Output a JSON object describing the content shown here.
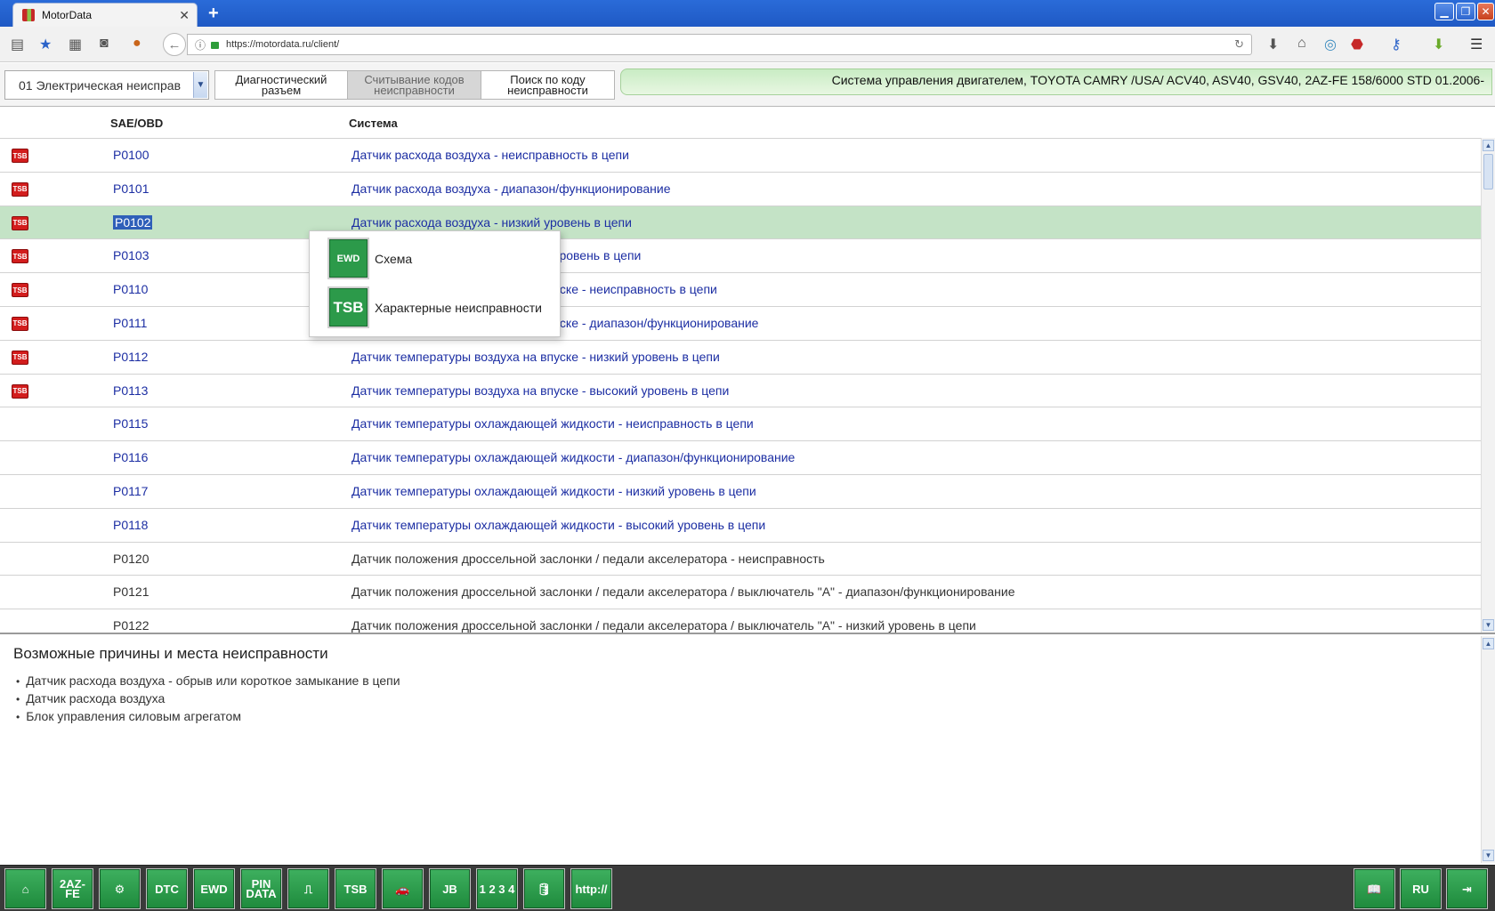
{
  "browser": {
    "tab_title": "MotorData",
    "url": "https://motordata.ru/client/",
    "newtab_label": "+",
    "tab_close": "✕"
  },
  "header": {
    "section_select": "01 Электрическая неисправ",
    "tabs": [
      {
        "label": "Диагностический разъем"
      },
      {
        "label": "Считывание кодов неисправности"
      },
      {
        "label": "Поиск по коду неисправности"
      }
    ],
    "vehicle": "Система управления двигателем, TOYOTA CAMRY /USA/ ACV40, ASV40, GSV40, 2AZ-FE 158/6000 STD 01.2006-"
  },
  "table": {
    "col_code": "SAE/OBD",
    "col_system": "Система",
    "rows": [
      {
        "tsb": true,
        "code": "P0100",
        "desc": "Датчик расхода воздуха - неисправность в цепи"
      },
      {
        "tsb": true,
        "code": "P0101",
        "desc": "Датчик расхода воздуха - диапазон/функционирование"
      },
      {
        "tsb": true,
        "code": "P0102",
        "desc": "Датчик расхода воздуха - низкий уровень в цепи",
        "selected": true
      },
      {
        "tsb": true,
        "code": "P0103",
        "desc": "Датчик расхода воздуха - высокий уровень в цепи"
      },
      {
        "tsb": true,
        "code": "P0110",
        "desc": "Датчик температуры воздуха на впуске - неисправность в цепи"
      },
      {
        "tsb": true,
        "code": "P0111",
        "desc": "Датчик температуры воздуха на впуске - диапазон/функционирование"
      },
      {
        "tsb": true,
        "code": "P0112",
        "desc": "Датчик температуры воздуха на впуске - низкий уровень в цепи"
      },
      {
        "tsb": true,
        "code": "P0113",
        "desc": "Датчик температуры воздуха на впуске - высокий уровень в цепи"
      },
      {
        "tsb": false,
        "code": "P0115",
        "desc": "Датчик температуры охлаждающей жидкости - неисправность в цепи"
      },
      {
        "tsb": false,
        "code": "P0116",
        "desc": "Датчик температуры охлаждающей жидкости - диапазон/функционирование"
      },
      {
        "tsb": false,
        "code": "P0117",
        "desc": "Датчик температуры охлаждающей жидкости - низкий уровень в цепи"
      },
      {
        "tsb": false,
        "code": "P0118",
        "desc": "Датчик температуры охлаждающей жидкости - высокий уровень в цепи"
      },
      {
        "tsb": false,
        "code": "P0120",
        "desc": "Датчик положения дроссельной заслонки / педали акселератора - неисправность",
        "plain": true
      },
      {
        "tsb": false,
        "code": "P0121",
        "desc": "Датчик положения дроссельной заслонки / педали акселератора / выключатель \"А\" - диапазон/функционирование",
        "plain": true
      },
      {
        "tsb": false,
        "code": "P0122",
        "desc": "Датчик положения дроссельной заслонки / педали акселератора / выключатель \"А\" - низкий уровень в цепи",
        "plain": true
      }
    ],
    "tsb_badge": "TSB"
  },
  "popup": {
    "items": [
      {
        "icon": "EWD",
        "label": "Схема"
      },
      {
        "icon": "TSB",
        "label": "Характерные неисправности"
      }
    ]
  },
  "causes": {
    "title": "Возможные причины и места неисправности",
    "items": [
      "Датчик расхода воздуха - обрыв или короткое замыкание в цепи",
      "Датчик расхода воздуха",
      "Блок управления силовым агрегатом"
    ]
  },
  "toolbar": {
    "left": [
      {
        "name": "home",
        "label": "⌂"
      },
      {
        "name": "engine",
        "label": "2AZ-FE"
      },
      {
        "name": "wheel",
        "label": "⚙"
      },
      {
        "name": "dtc",
        "label": "DTC"
      },
      {
        "name": "ewd",
        "label": "EWD"
      },
      {
        "name": "pin-data",
        "label": "PIN DATA"
      },
      {
        "name": "tester",
        "label": "⎍"
      },
      {
        "name": "tsb",
        "label": "TSB"
      },
      {
        "name": "service-car",
        "label": "🚗"
      },
      {
        "name": "jb",
        "label": "JB"
      },
      {
        "name": "relay",
        "label": "1 2 3 4"
      },
      {
        "name": "oil",
        "label": "🛢"
      },
      {
        "name": "http",
        "label": "http://"
      }
    ],
    "right": [
      {
        "name": "manual",
        "label": "📖"
      },
      {
        "name": "language",
        "label": "RU"
      },
      {
        "name": "exit",
        "label": "⇥"
      }
    ]
  }
}
